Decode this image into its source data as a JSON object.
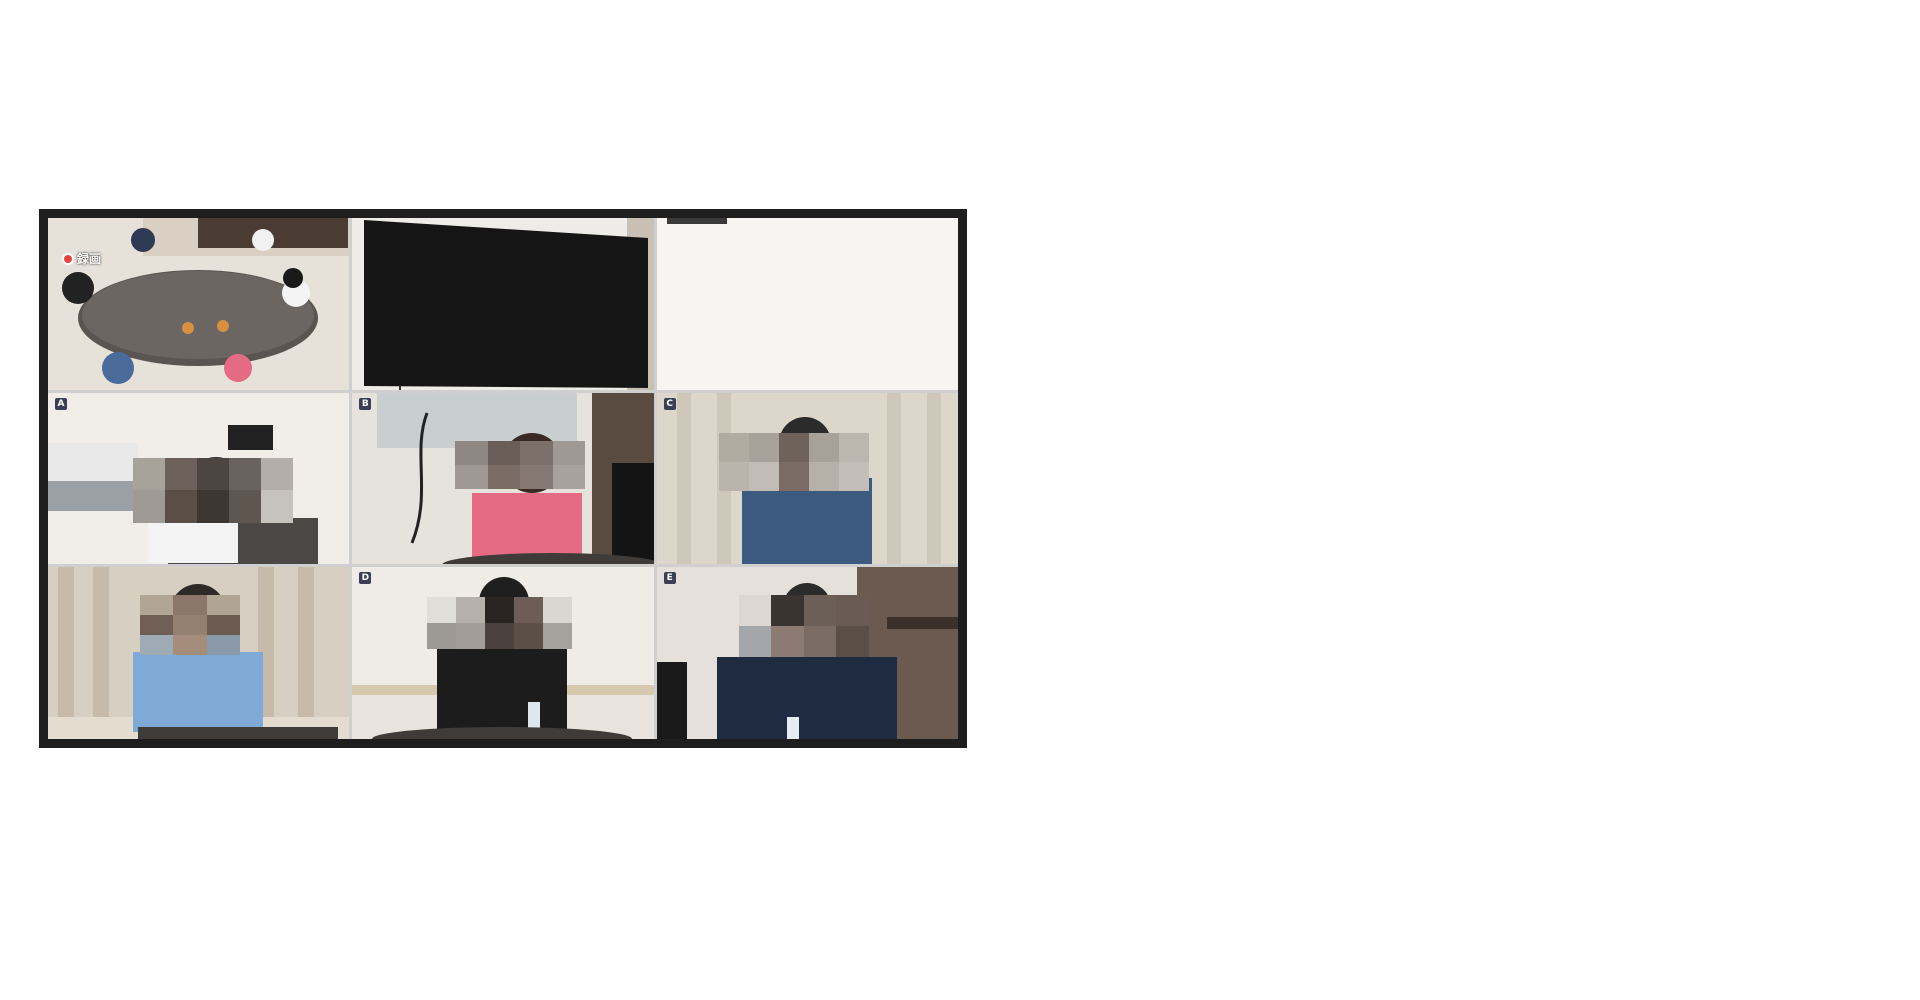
{
  "cells": [
    {
      "id": "overview",
      "label": "",
      "recording": "録画"
    },
    {
      "id": "tv",
      "label": ""
    },
    {
      "id": "empty",
      "label": ""
    },
    {
      "id": "cam-a",
      "label": "A"
    },
    {
      "id": "cam-b",
      "label": "B"
    },
    {
      "id": "cam-c",
      "label": "C"
    },
    {
      "id": "cam-side",
      "label": ""
    },
    {
      "id": "cam-d",
      "label": "D"
    },
    {
      "id": "cam-e",
      "label": "E"
    }
  ],
  "colors": {
    "frame": "#1e1e1e",
    "rec": "#e8423e",
    "pink": "#e56b85",
    "denim": "#3d5a80",
    "light_blue": "#7fa9d6",
    "navy": "#1f2b40"
  }
}
